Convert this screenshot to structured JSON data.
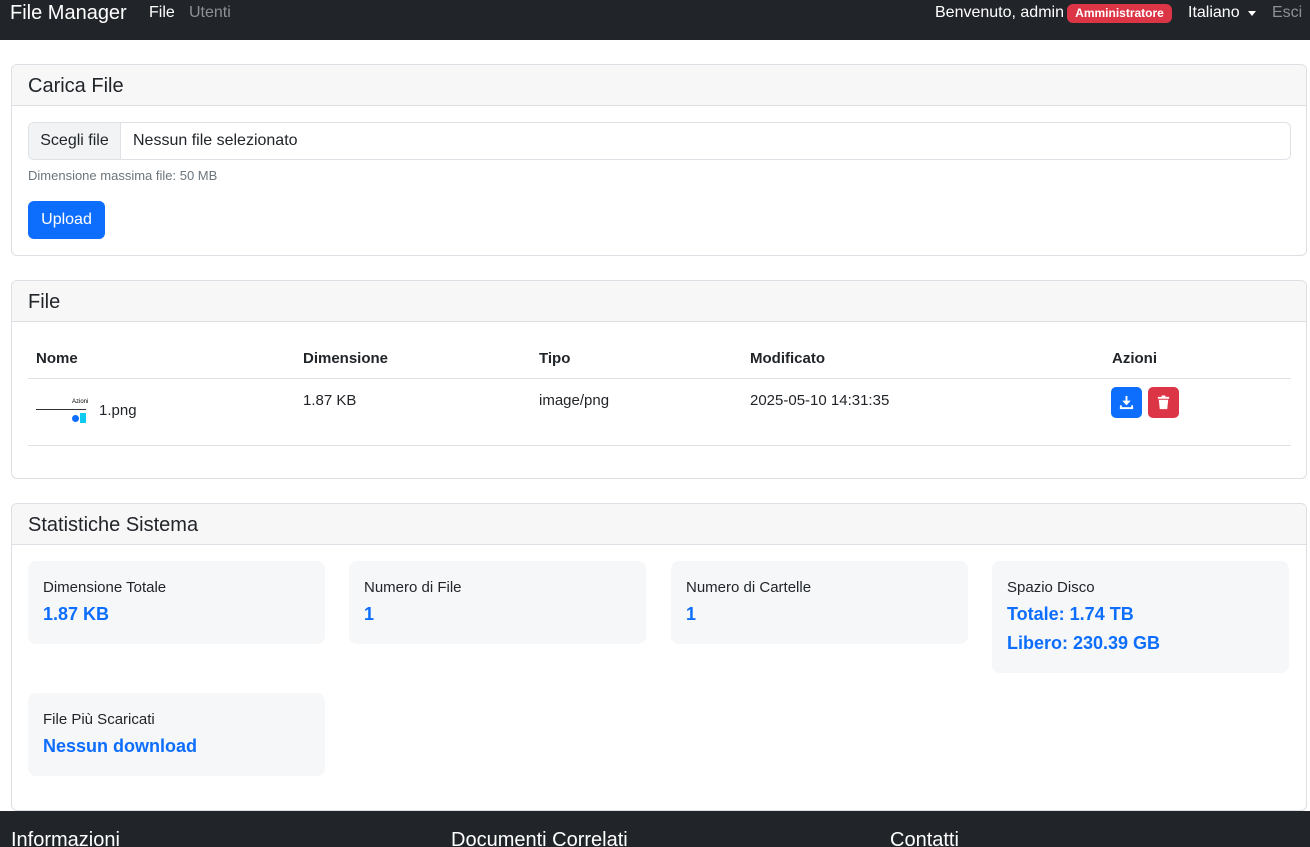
{
  "navbar": {
    "brand": "File Manager",
    "nav_file": "File",
    "nav_users": "Utenti",
    "welcome": "Benvenuto, admin",
    "role_badge": "Amministratore",
    "language": "Italiano",
    "logout": "Esci"
  },
  "upload": {
    "title": "Carica File",
    "choose_label": "Scegli file",
    "no_file": "Nessun file selezionato",
    "max_size": "Dimensione massima file: 50 MB",
    "upload_button": "Upload"
  },
  "files": {
    "title": "File",
    "columns": [
      "Nome",
      "Dimensione",
      "Tipo",
      "Modificato",
      "Azioni"
    ],
    "rows": [
      {
        "name": "1.png",
        "size": "1.87 KB",
        "type": "image/png",
        "modified": "2025-05-10 14:31:35",
        "thumbnail_text": "Azioni"
      }
    ]
  },
  "stats": {
    "title": "Statistiche Sistema",
    "total_size_label": "Dimensione Totale",
    "total_size_value": "1.87 KB",
    "file_count_label": "Numero di File",
    "file_count_value": "1",
    "folder_count_label": "Numero di Cartelle",
    "folder_count_value": "1",
    "disk_label": "Spazio Disco",
    "disk_total": "Totale: 1.74 TB",
    "disk_free": "Libero: 230.39 GB",
    "top_downloads_label": "File Più Scaricati",
    "top_downloads_value": "Nessun download"
  },
  "footer": {
    "info": "Informazioni",
    "docs": "Documenti Correlati",
    "contacts": "Contatti"
  },
  "colors": {
    "navbar_bg": "#212529",
    "primary": "#0d6efd",
    "danger": "#dc3545",
    "card_header_bg": "#f7f7f7",
    "stat_bg": "#f6f7f8"
  },
  "icons": [
    "download-icon",
    "trash-icon",
    "caret-down-icon"
  ]
}
